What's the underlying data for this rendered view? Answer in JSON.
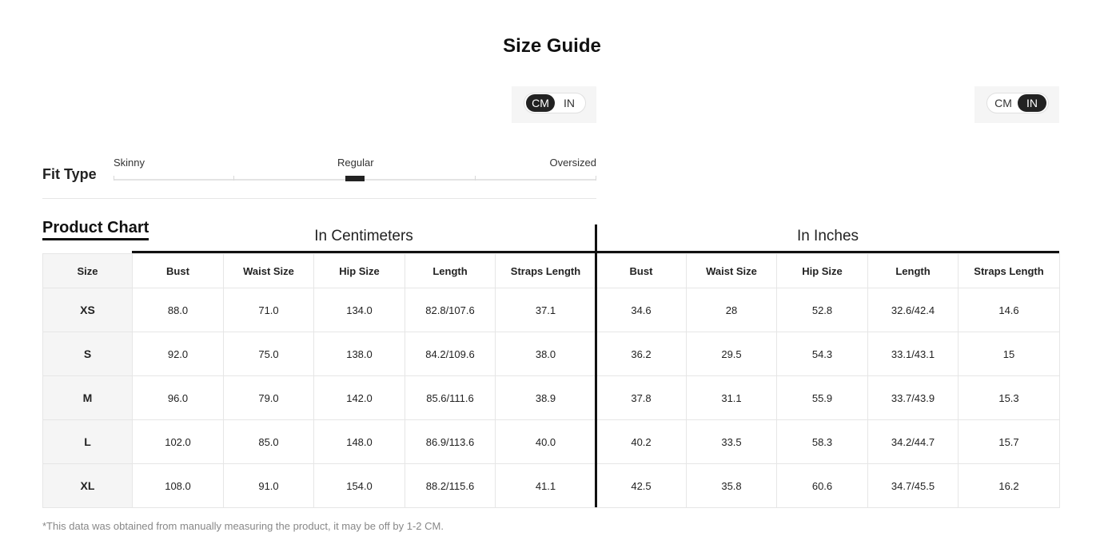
{
  "title": "Size Guide",
  "unit_toggles": [
    {
      "options": [
        "CM",
        "IN"
      ],
      "active": "CM"
    },
    {
      "options": [
        "CM",
        "IN"
      ],
      "active": "IN"
    }
  ],
  "fit_type": {
    "label": "Fit Type",
    "scale_labels": [
      "Skinny",
      "Regular",
      "Oversized"
    ],
    "selected": "Regular"
  },
  "product_chart": {
    "label": "Product Chart",
    "group_cm": "In Centimeters",
    "group_in": "In Inches",
    "columns": [
      "Size",
      "Bust",
      "Waist Size",
      "Hip Size",
      "Length",
      "Straps Length",
      "Bust",
      "Waist Size",
      "Hip Size",
      "Length",
      "Straps Length"
    ],
    "rows": [
      [
        "XS",
        "88.0",
        "71.0",
        "134.0",
        "82.8/107.6",
        "37.1",
        "34.6",
        "28",
        "52.8",
        "32.6/42.4",
        "14.6"
      ],
      [
        "S",
        "92.0",
        "75.0",
        "138.0",
        "84.2/109.6",
        "38.0",
        "36.2",
        "29.5",
        "54.3",
        "33.1/43.1",
        "15"
      ],
      [
        "M",
        "96.0",
        "79.0",
        "142.0",
        "85.6/111.6",
        "38.9",
        "37.8",
        "31.1",
        "55.9",
        "33.7/43.9",
        "15.3"
      ],
      [
        "L",
        "102.0",
        "85.0",
        "148.0",
        "86.9/113.6",
        "40.0",
        "40.2",
        "33.5",
        "58.3",
        "34.2/44.7",
        "15.7"
      ],
      [
        "XL",
        "108.0",
        "91.0",
        "154.0",
        "88.2/115.6",
        "41.1",
        "42.5",
        "35.8",
        "60.6",
        "34.7/45.5",
        "16.2"
      ]
    ]
  },
  "footnote": "*This data was obtained from manually measuring the product, it may be off by 1-2 CM."
}
